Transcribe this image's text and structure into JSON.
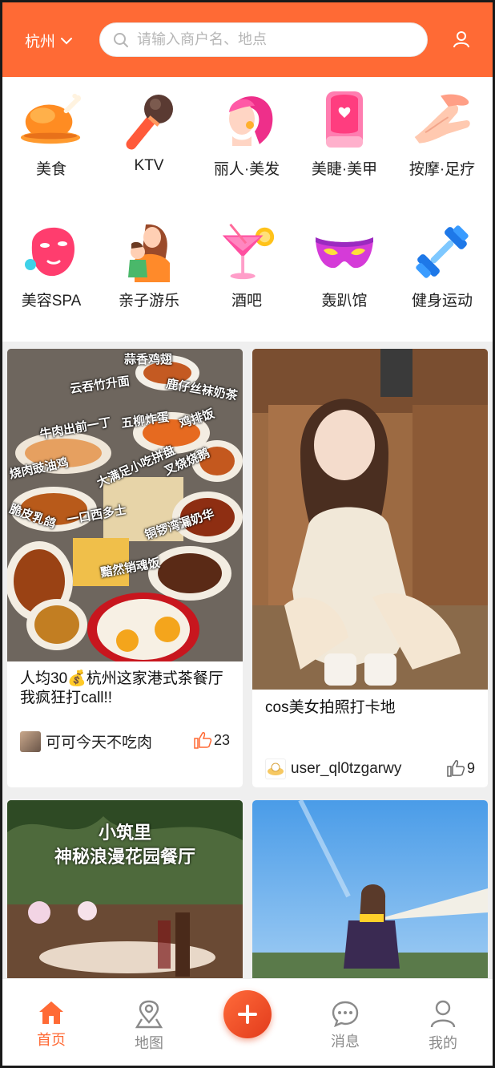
{
  "header": {
    "city": "杭州",
    "search_placeholder": "请输入商户名、地点"
  },
  "categories": [
    {
      "label": "美食",
      "icon": "roast-chicken-icon"
    },
    {
      "label": "KTV",
      "icon": "microphone-icon"
    },
    {
      "label": "丽人·美发",
      "icon": "woman-hair-icon"
    },
    {
      "label": "美睫·美甲",
      "icon": "nail-icon"
    },
    {
      "label": "按摩·足疗",
      "icon": "massage-hand-icon"
    },
    {
      "label": "美容SPA",
      "icon": "face-mask-icon"
    },
    {
      "label": "亲子游乐",
      "icon": "mother-child-icon"
    },
    {
      "label": "酒吧",
      "icon": "cocktail-icon"
    },
    {
      "label": "轰趴馆",
      "icon": "party-mask-icon"
    },
    {
      "label": "健身运动",
      "icon": "dumbbell-icon"
    }
  ],
  "feed": [
    {
      "title": "人均30💰杭州这家港式茶餐厅我疯狂打call!!",
      "author": "可可今天不吃肉",
      "likes": "23",
      "image_text": [
        "蒜香鸡翅",
        "云吞竹升面",
        "鹿仔丝袜奶茶",
        "牛肉出前一丁",
        "五柳炸蛋",
        "鸡排饭",
        "烧肉豉油鸡",
        "大满足小吃拼盘",
        "叉烧烧鹅",
        "脆皮乳鸽",
        "一口西多士",
        "铜锣湾漏奶华",
        "黯然销魂饭"
      ]
    },
    {
      "title": "cos美女拍照打卡地",
      "author": "user_ql0tzgarwy",
      "likes": "9"
    },
    {
      "title": "",
      "author": "",
      "likes": "",
      "image_text": [
        "小筑里",
        "神秘浪漫花园餐厅"
      ]
    },
    {
      "title": "",
      "author": "",
      "likes": ""
    }
  ],
  "tabbar": {
    "home": "首页",
    "map": "地图",
    "messages": "消息",
    "mine": "我的"
  },
  "colors": {
    "brand": "#ff6a35",
    "inactive": "#8a8a8a"
  }
}
